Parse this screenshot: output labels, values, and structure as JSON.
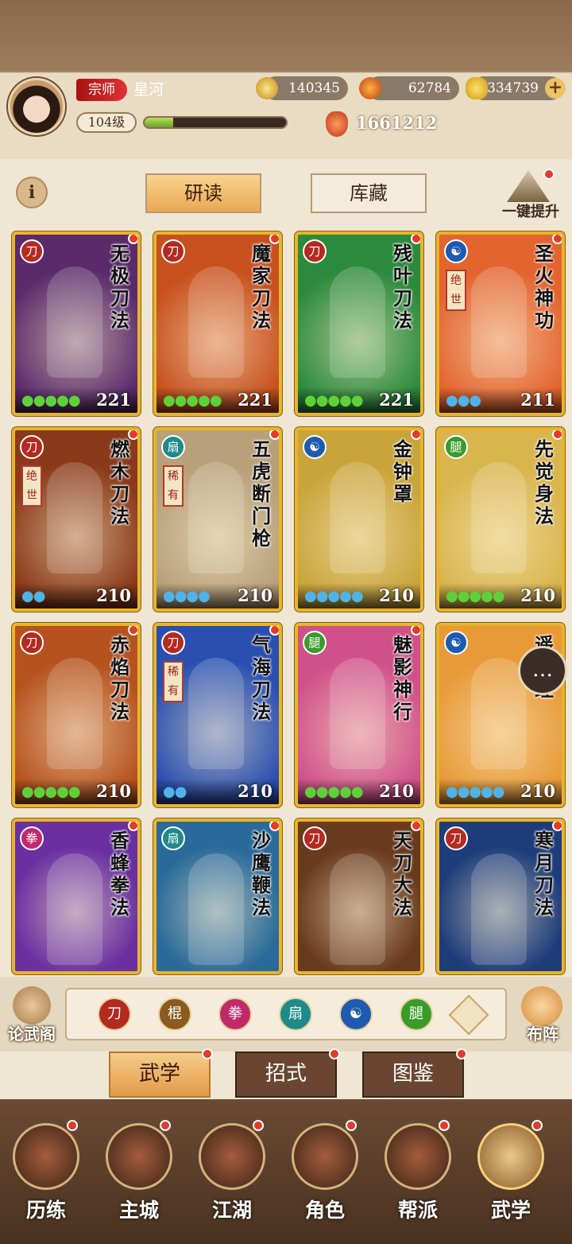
{
  "player": {
    "rank": "宗师",
    "name": "星河",
    "level": "104级",
    "exp_fraction": 0.2,
    "power": "1661212"
  },
  "currencies": [
    {
      "name": "coin-icon",
      "value": "140345"
    },
    {
      "name": "flame-icon",
      "value": "62784"
    },
    {
      "name": "gold-ingot-icon",
      "value": "334739"
    }
  ],
  "toolbar": {
    "info": "i",
    "research": "研读",
    "library": "库藏",
    "upgrade": "一键提升"
  },
  "cards": [
    {
      "title": "无极刀法",
      "element": "blade",
      "tag": "",
      "drops": "●●●●●",
      "level": "221",
      "bg": "#5a2a6b"
    },
    {
      "title": "魔家刀法",
      "element": "blade",
      "tag": "",
      "drops": "●●●●●",
      "level": "221",
      "bg": "#c8501e"
    },
    {
      "title": "残叶刀法",
      "element": "blade",
      "tag": "",
      "drops": "●●●●●",
      "level": "221",
      "bg": "#2c8a3d"
    },
    {
      "title": "圣火神功",
      "element": "taiji",
      "tag": "绝世",
      "drops": "●●●",
      "level": "211",
      "bg": "#e3642f"
    },
    {
      "title": "燃木刀法",
      "element": "blade",
      "tag": "绝世",
      "drops": "●●",
      "level": "210",
      "bg": "#8a3a1a"
    },
    {
      "title": "五虎断门枪",
      "element": "fan",
      "tag": "稀有",
      "drops": "●●●●",
      "level": "210",
      "bg": "#b8a07a"
    },
    {
      "title": "金钟罩",
      "element": "taiji",
      "tag": "",
      "drops": "●●●●●",
      "level": "210",
      "bg": "#c9a43a"
    },
    {
      "title": "先觉身法",
      "element": "kick",
      "tag": "",
      "drops": "●●●●●",
      "level": "210",
      "bg": "#d9b54e"
    },
    {
      "title": "赤焰刀法",
      "element": "blade",
      "tag": "",
      "drops": "●●●●●",
      "level": "210",
      "bg": "#b5521e"
    },
    {
      "title": "气海刀法",
      "element": "blade",
      "tag": "稀有",
      "drops": "●●",
      "level": "210",
      "bg": "#2a4fb0"
    },
    {
      "title": "魅影神行",
      "element": "kick",
      "tag": "",
      "drops": "●●●●●",
      "level": "210",
      "bg": "#d0508a"
    },
    {
      "title": "遥心经",
      "element": "taiji",
      "tag": "",
      "drops": "●●●●●",
      "level": "210",
      "bg": "#e89a38"
    },
    {
      "title": "香蜂拳法",
      "element": "fist",
      "tag": "",
      "drops": "",
      "level": "",
      "bg": "#6a2fa0"
    },
    {
      "title": "沙鹰鞭法",
      "element": "fan",
      "tag": "",
      "drops": "",
      "level": "",
      "bg": "#2a6a9a"
    },
    {
      "title": "天刀大法",
      "element": "blade",
      "tag": "",
      "drops": "",
      "level": "",
      "bg": "#6a3a1e"
    },
    {
      "title": "寒月刀法",
      "element": "blade",
      "tag": "",
      "drops": "",
      "level": "",
      "bg": "#1e3c7a"
    }
  ],
  "bottom": {
    "lunwu": "论武阁",
    "buzhen": "布阵",
    "filters": [
      {
        "name": "blade-filter-icon",
        "color": "#b32a20",
        "glyph": "刀"
      },
      {
        "name": "staff-filter-icon",
        "color": "#8a5a1e",
        "glyph": "棍"
      },
      {
        "name": "fist-filter-icon",
        "color": "#c02a6a",
        "glyph": "拳"
      },
      {
        "name": "fan-filter-icon",
        "color": "#1e8a8a",
        "glyph": "扇"
      },
      {
        "name": "taiji-filter-icon",
        "color": "#1e5ab0",
        "glyph": "☯"
      },
      {
        "name": "kick-filter-icon",
        "color": "#3a9a2a",
        "glyph": "腿"
      }
    ]
  },
  "tabs": {
    "martial": "武学",
    "moves": "招式",
    "atlas": "图鉴"
  },
  "nav": [
    {
      "label": "历练",
      "icon": "training-icon"
    },
    {
      "label": "主城",
      "icon": "city-icon"
    },
    {
      "label": "江湖",
      "icon": "jianghu-icon"
    },
    {
      "label": "角色",
      "icon": "character-icon"
    },
    {
      "label": "帮派",
      "icon": "guild-icon"
    },
    {
      "label": "武学",
      "icon": "martial-arts-icon"
    }
  ]
}
